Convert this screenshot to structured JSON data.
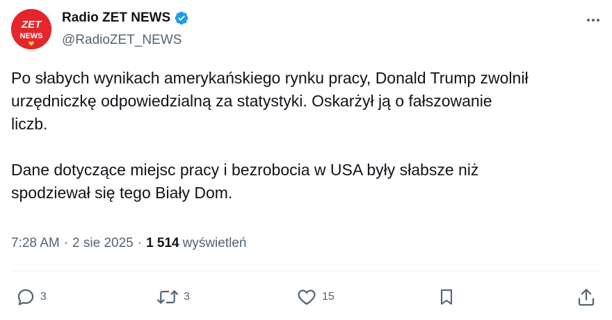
{
  "author": {
    "name": "Radio ZET NEWS",
    "handle": "@RadioZET_NEWS",
    "avatar_text_top": "ZET",
    "avatar_text_bottom": "NEWS",
    "verified_icon": "verified-badge-icon"
  },
  "tweet": {
    "paragraph1_lines": [
      "Po słabych wynikach amerykańskiego rynku pracy, Donald Trump zwolnił",
      "urzędniczkę odpowiedzialną za statystyki. Oskarżył ją o fałszowanie",
      "liczb."
    ],
    "paragraph2_lines": [
      "Dane dotyczące miejsc pracy i bezrobocia w USA były słabsze niż",
      "spodziewał się tego Biały Dom."
    ]
  },
  "meta": {
    "time": "7:28 AM",
    "separator": "·",
    "date": "2 sie 2025",
    "views_count": "1 514",
    "views_label": "wyświetleń"
  },
  "actions": {
    "replies": "3",
    "reposts": "3",
    "likes": "15"
  },
  "colors": {
    "text": "#0f1419",
    "secondary": "#536471",
    "verified": "#1d9bf0",
    "avatar_bg": "#e3262b"
  }
}
